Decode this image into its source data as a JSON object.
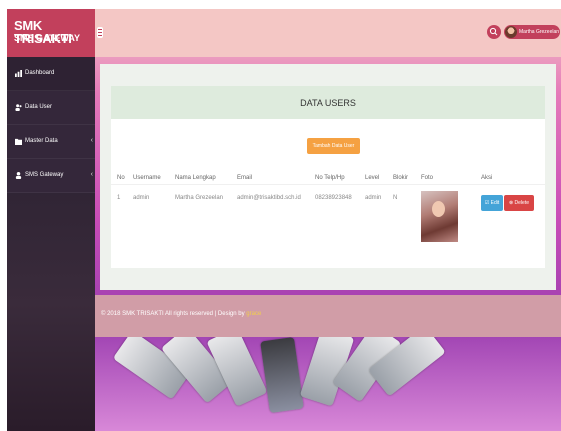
{
  "brand": {
    "title": "SMK TRISAKTI",
    "subtitle": "SMS GATEWAY"
  },
  "sidebar": {
    "items": [
      {
        "label": "Dashboard",
        "icon": "dashboard-icon",
        "has_children": false
      },
      {
        "label": "Data User",
        "icon": "users-icon",
        "has_children": false
      },
      {
        "label": "Master Data",
        "icon": "folder-icon",
        "has_children": true
      },
      {
        "label": "SMS Gateway",
        "icon": "user-icon",
        "has_children": true
      }
    ],
    "chevron": "‹"
  },
  "topbar": {
    "user_name": "Martha Grezeelan"
  },
  "panel": {
    "title": "DATA USERS",
    "add_button": "Tambah Data User",
    "columns": [
      "No",
      "Username",
      "Nama Lengkap",
      "Email",
      "No Telp/Hp",
      "Level",
      "Blokir",
      "Foto",
      "Aksi"
    ],
    "rows": [
      {
        "no": "1",
        "username": "admin",
        "nama": "Martha Grezeelan",
        "email": "admin@trisaktibd.sch.id",
        "telp": "08238923848",
        "level": "admin",
        "blokir": "N",
        "edit": "☑ Edit",
        "delete": "⊗ Delete"
      }
    ]
  },
  "footer": {
    "text": "© 2018 SMK TRISAKTI All rights reserved | Design by",
    "designer": "grace"
  },
  "colors": {
    "brand": "#c2405c",
    "topbar": "#f4c7c5",
    "header_box": "#deebdd",
    "add_button": "#f5a142",
    "edit": "#44a4d8",
    "delete": "#d94545"
  }
}
